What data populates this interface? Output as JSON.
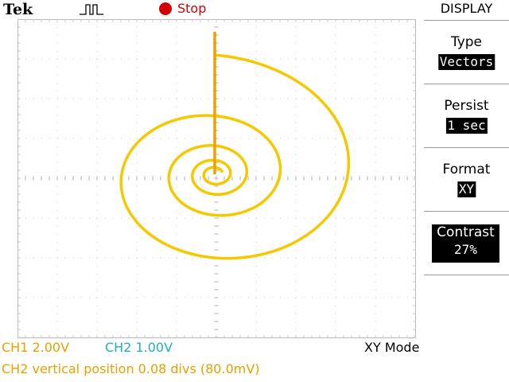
{
  "header": {
    "brand": "Tek",
    "trigger_icon": "pulse-trigger-icon",
    "status": "Stop",
    "status_color": "#d40000"
  },
  "menu": {
    "title": "DISPLAY",
    "items": [
      {
        "label": "Type",
        "value": "Vectors"
      },
      {
        "label": "Persist",
        "value": "1 sec"
      },
      {
        "label": "Format",
        "value": "XY"
      },
      {
        "label": "Contrast",
        "value": "27%"
      }
    ]
  },
  "status_bar": {
    "ch1": "CH1  2.00V",
    "ch1_color": "#e8a000",
    "ch2": "CH2  1.00V",
    "ch2_color": "#1fb0b8",
    "mode": "XY Mode",
    "message": "CH2 vertical position 0.08 divs (80.0mV)"
  },
  "trace": {
    "color": "#f5c800"
  }
}
